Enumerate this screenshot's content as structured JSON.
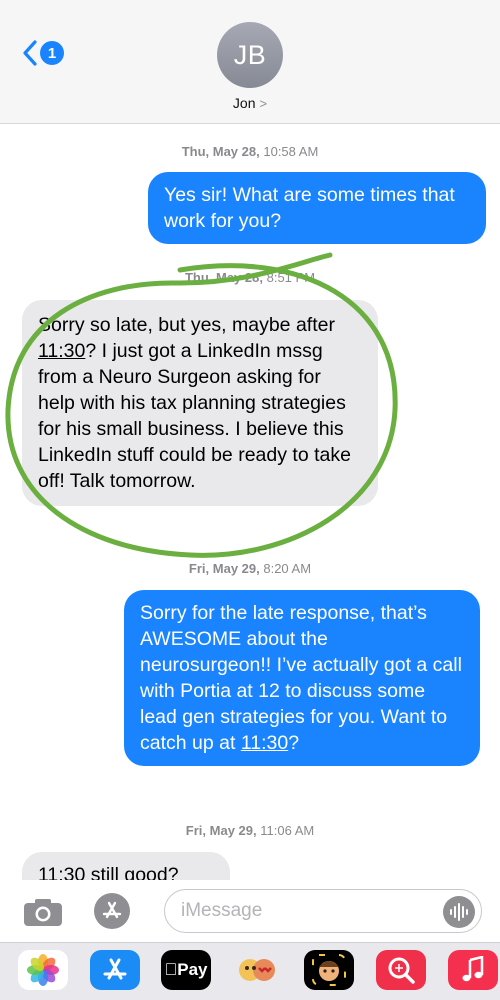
{
  "header": {
    "unread_count": "1",
    "avatar_initials": "JB",
    "contact_name": "Jon",
    "contact_chevron": ">"
  },
  "messages": [
    {
      "type": "timestamp",
      "day": "Thu, May 28,",
      "time": "10:58 AM"
    },
    {
      "type": "outgoing",
      "text": "Yes sir! What are some times that work for you?"
    },
    {
      "type": "timestamp",
      "day": "Thu, May 28,",
      "time": "8:51 PM"
    },
    {
      "type": "incoming",
      "text_before": "Sorry so late, but yes, maybe after ",
      "link": "11:30",
      "text_after": "? I just got a LinkedIn mssg from a Neuro Surgeon asking for help with his tax planning strategies for his small business. I believe this LinkedIn stuff could be ready to take off! Talk tomorrow."
    },
    {
      "type": "timestamp",
      "day": "Fri, May 29,",
      "time": "8:20 AM"
    },
    {
      "type": "outgoing",
      "text_before": "Sorry for the late response, that’s AWESOME about the neurosurgeon!! I’ve actually got a call with Portia at 12 to discuss some lead gen strategies for you. Want to catch up at ",
      "link": "11:30",
      "text_after": "?"
    },
    {
      "type": "timestamp",
      "day": "Fri, May 29,",
      "time": "11:06 AM"
    },
    {
      "type": "incoming",
      "text": "11:30 still good?"
    }
  ],
  "composer": {
    "placeholder": "iMessage"
  },
  "app_drawer": {
    "apps": [
      {
        "name": "photos-icon"
      },
      {
        "name": "app-store-icon"
      },
      {
        "name": "apple-pay-icon",
        "label": "Pay"
      },
      {
        "name": "memoji-stickers-icon"
      },
      {
        "name": "animoji-icon"
      },
      {
        "name": "images-search-icon"
      },
      {
        "name": "music-icon"
      }
    ]
  },
  "colors": {
    "outgoing_bubble": "#1a84ff",
    "incoming_bubble": "#e9e9eb",
    "highlight_ring": "#6aaf3f"
  }
}
